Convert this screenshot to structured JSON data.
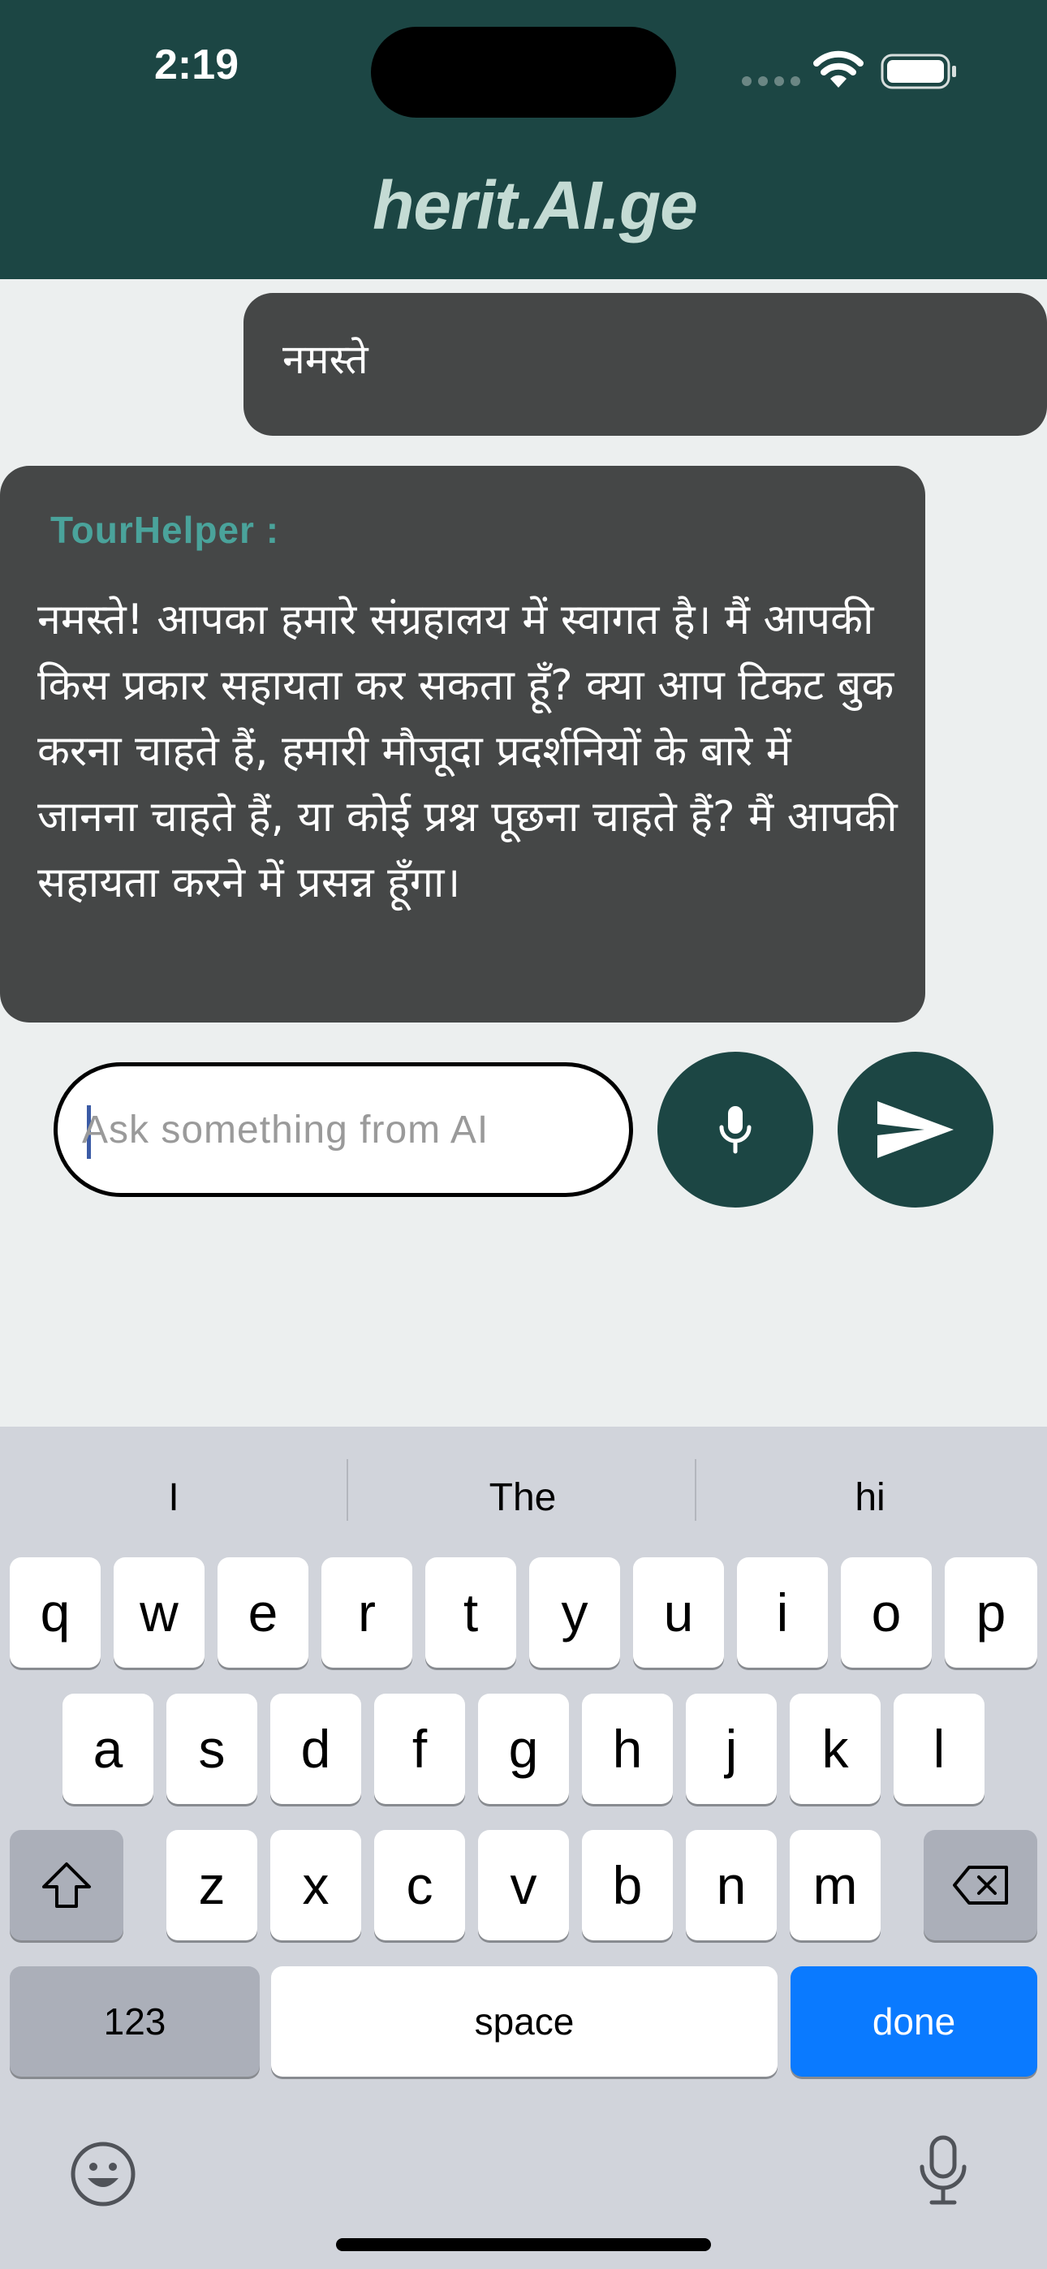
{
  "status_bar": {
    "time": "2:19"
  },
  "header": {
    "title": "herit.AI.ge"
  },
  "chat": {
    "user_message": "नमस्ते",
    "bot_sender": "TourHelper :",
    "bot_message": "नमस्ते! आपका हमारे संग्रहालय में स्वागत है। मैं आपकी किस प्रकार सहायता कर सकता हूँ? क्या आप टिकट बुक करना चाहते हैं, हमारी मौजूदा प्रदर्शनियों के बारे में जानना चाहते हैं, या कोई प्रश्न पूछना चाहते हैं? मैं आपकी सहायता करने में प्रसन्न हूँगा।"
  },
  "composer": {
    "placeholder": "Ask something from AI",
    "value": ""
  },
  "keyboard": {
    "suggestions": [
      "I",
      "The",
      "hi"
    ],
    "row1": [
      "q",
      "w",
      "e",
      "r",
      "t",
      "y",
      "u",
      "i",
      "o",
      "p"
    ],
    "row2": [
      "a",
      "s",
      "d",
      "f",
      "g",
      "h",
      "j",
      "k",
      "l"
    ],
    "row3": [
      "z",
      "x",
      "c",
      "v",
      "b",
      "n",
      "m"
    ],
    "numbers_label": "123",
    "space_label": "space",
    "done_label": "done"
  },
  "colors": {
    "header_bg": "#1c4644",
    "title": "#c4dbd4",
    "bubble": "#454747",
    "sender": "#4aa39b",
    "accent_button": "#1c4644",
    "done_key": "#0a7aff"
  },
  "icons": [
    "wifi-icon",
    "battery-icon",
    "microphone-icon",
    "send-icon",
    "shift-icon",
    "backspace-icon",
    "emoji-icon",
    "dictation-icon"
  ]
}
